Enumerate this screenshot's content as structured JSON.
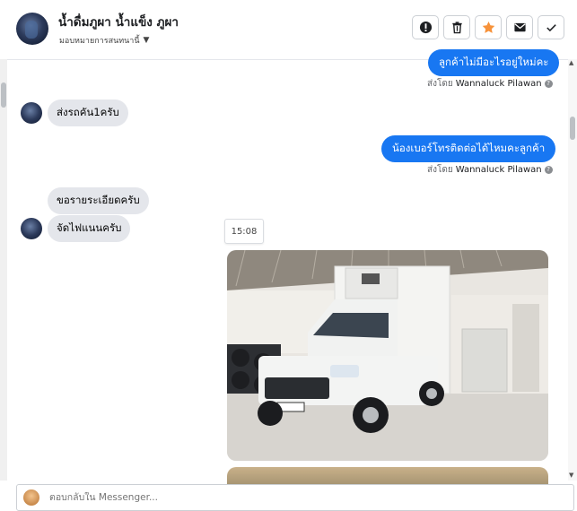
{
  "header": {
    "name": "น้ำดื่มภูผา น้ำแข็ง ภูผา",
    "subtitle": "มอบหมายการสนทนานี้",
    "actions": [
      {
        "name": "mark-spam-button",
        "icon": "alert-icon"
      },
      {
        "name": "delete-button",
        "icon": "trash-icon"
      },
      {
        "name": "star-button",
        "icon": "star-icon",
        "color": "#f7923a"
      },
      {
        "name": "mark-unread-button",
        "icon": "mail-icon"
      },
      {
        "name": "done-button",
        "icon": "check-icon"
      }
    ]
  },
  "messages": [
    {
      "direction": "out",
      "text": "ลูกค้าไม่มีอะไรอยู่ใหม่คะ",
      "sent_by_prefix": "ส่งโดย",
      "sent_by": "Wannaluck Pilawan"
    },
    {
      "direction": "in",
      "text": "ส่งรถคัน1ครับ"
    },
    {
      "direction": "out",
      "text": "น้องเบอร์โทรติดต่อได้ไหมคะลูกค้า",
      "sent_by_prefix": "ส่งโดย",
      "sent_by": "Wannaluck Pilawan"
    },
    {
      "direction": "in",
      "text": "ขอรายระเอียดครับ"
    },
    {
      "direction": "in",
      "text": "จัดไฟแนนครับ"
    }
  ],
  "timestamp": "15:08",
  "help_glyph": "?",
  "compose": {
    "placeholder": "ตอบกลับใน Messenger..."
  },
  "colors": {
    "accent": "#1877f2",
    "bubble_in": "#e4e6eb",
    "star": "#f7923a"
  }
}
